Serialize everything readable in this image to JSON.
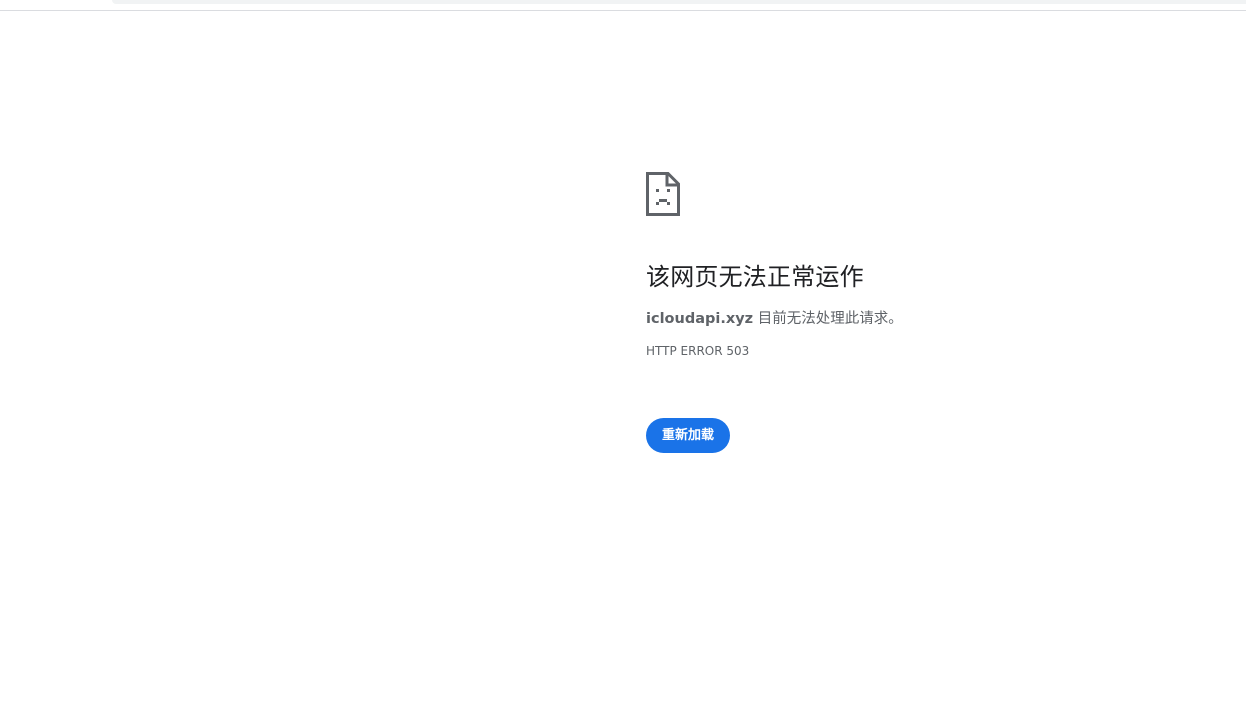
{
  "error_page": {
    "icon": "sad-page-icon",
    "title": "该网页无法正常运作",
    "host": "icloudapi.xyz",
    "message_suffix": " 目前无法处理此请求。",
    "error_code": "HTTP ERROR 503",
    "reload_label": "重新加载"
  },
  "colors": {
    "accent": "#1a73e8",
    "title_text": "#202124",
    "secondary_text": "#5f6368"
  }
}
